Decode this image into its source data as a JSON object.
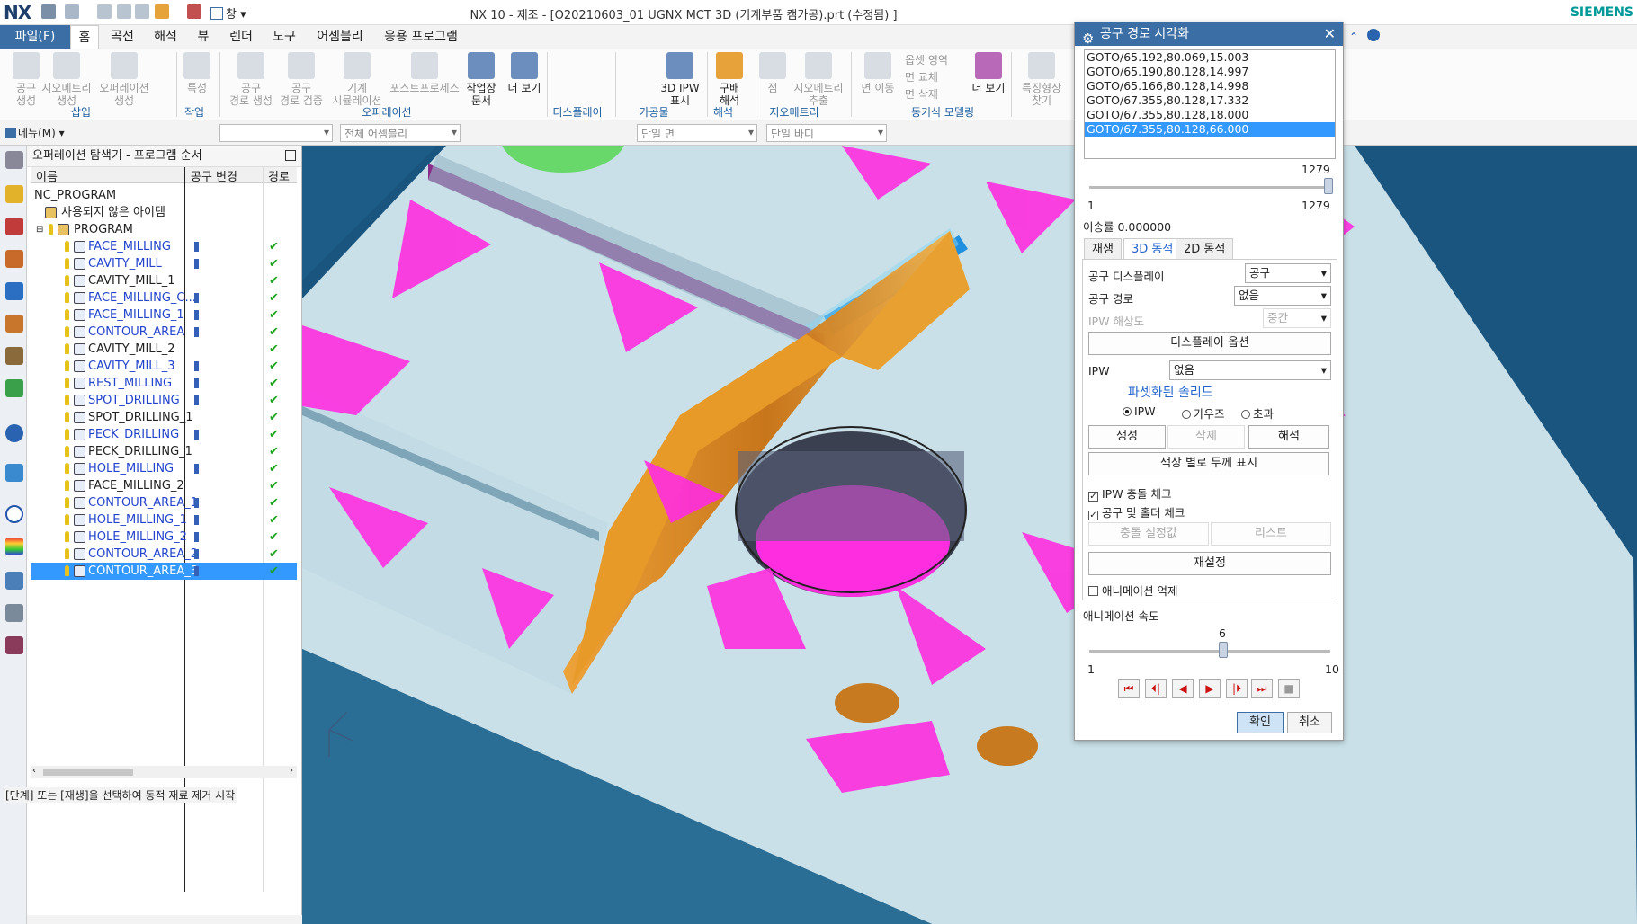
{
  "app": {
    "logo": "NX",
    "title": "NX 10 - 제조 - [O20210603_01 UGNX MCT 3D (기계부품 캠가공).prt (수정됨) ]",
    "brand": "SIEMENS",
    "window_menu": "창"
  },
  "tabs": [
    "파일(F)",
    "홈",
    "곡선",
    "해석",
    "뷰",
    "렌더",
    "도구",
    "어셈블리",
    "응용 프로그램"
  ],
  "ribbon": {
    "buttons": [
      {
        "label": "공구\n생성",
        "enabled": false
      },
      {
        "label": "지오메트리\n생성",
        "enabled": false
      },
      {
        "label": "오퍼레이션\n생성",
        "enabled": false
      },
      {
        "label": "특성",
        "enabled": false
      },
      {
        "label": "공구\n경로 생성",
        "enabled": false
      },
      {
        "label": "공구\n경로 검증",
        "enabled": false
      },
      {
        "label": "기계\n시뮬레이션",
        "enabled": false
      },
      {
        "label": "포스트프로세스",
        "enabled": false
      },
      {
        "label": "작업장\n문서",
        "enabled": true
      },
      {
        "label": "더 보기",
        "enabled": true
      },
      {
        "label": "3D IPW\n표시",
        "enabled": true
      },
      {
        "label": "구배\n해석",
        "enabled": true
      },
      {
        "label": "점",
        "enabled": false
      },
      {
        "label": "지오메트리\n추출",
        "enabled": false
      },
      {
        "label": "면 이동",
        "enabled": false
      },
      {
        "label": "옵셋 영역",
        "enabled": false
      },
      {
        "label": "면 교체",
        "enabled": false
      },
      {
        "label": "면 삭제",
        "enabled": false
      },
      {
        "label": "더 보기",
        "enabled": true
      },
      {
        "label": "특징형상\n찾기",
        "enabled": false
      }
    ],
    "groups": [
      "삽입",
      "작업",
      "오퍼레이션",
      "디스플레이",
      "가공물",
      "해석",
      "지오메트리",
      "동기식 모델링"
    ]
  },
  "toolbar2": {
    "menu_label": "메뉴(M)",
    "filter1": "",
    "filter2": "전체 어셈블리",
    "filter3": "단일 면",
    "filter4": "단일 바디"
  },
  "navigator": {
    "title": "오퍼레이션 탐색기 - 프로그램 순서",
    "columns": [
      "이름",
      "공구 변경",
      "경로"
    ],
    "root": "NC_PROGRAM",
    "unused": "사용되지 않은 아이템",
    "program": "PROGRAM",
    "operations": [
      {
        "name": "FACE_MILLING",
        "tool_change": true,
        "path_ok": true,
        "style": "blue"
      },
      {
        "name": "CAVITY_MILL",
        "tool_change": true,
        "path_ok": true,
        "style": "blue"
      },
      {
        "name": "CAVITY_MILL_1",
        "tool_change": false,
        "path_ok": true,
        "style": "dark"
      },
      {
        "name": "FACE_MILLING_C...",
        "tool_change": true,
        "path_ok": true,
        "style": "blue"
      },
      {
        "name": "FACE_MILLING_1",
        "tool_change": true,
        "path_ok": true,
        "style": "blue"
      },
      {
        "name": "CONTOUR_AREA",
        "tool_change": true,
        "path_ok": true,
        "style": "blue"
      },
      {
        "name": "CAVITY_MILL_2",
        "tool_change": false,
        "path_ok": true,
        "style": "dark"
      },
      {
        "name": "CAVITY_MILL_3",
        "tool_change": true,
        "path_ok": true,
        "style": "blue"
      },
      {
        "name": "REST_MILLING",
        "tool_change": true,
        "path_ok": true,
        "style": "blue"
      },
      {
        "name": "SPOT_DRILLING",
        "tool_change": true,
        "path_ok": true,
        "style": "blue"
      },
      {
        "name": "SPOT_DRILLING_1",
        "tool_change": false,
        "path_ok": true,
        "style": "dark"
      },
      {
        "name": "PECK_DRILLING",
        "tool_change": true,
        "path_ok": true,
        "style": "blue"
      },
      {
        "name": "PECK_DRILLING_1",
        "tool_change": false,
        "path_ok": true,
        "style": "dark"
      },
      {
        "name": "HOLE_MILLING",
        "tool_change": true,
        "path_ok": true,
        "style": "blue"
      },
      {
        "name": "FACE_MILLING_2",
        "tool_change": false,
        "path_ok": true,
        "style": "dark"
      },
      {
        "name": "CONTOUR_AREA_1",
        "tool_change": true,
        "path_ok": true,
        "style": "blue"
      },
      {
        "name": "HOLE_MILLING_1",
        "tool_change": true,
        "path_ok": true,
        "style": "blue"
      },
      {
        "name": "HOLE_MILLING_2",
        "tool_change": true,
        "path_ok": true,
        "style": "blue"
      },
      {
        "name": "CONTOUR_AREA_2",
        "tool_change": true,
        "path_ok": true,
        "style": "blue"
      },
      {
        "name": "CONTOUR_AREA_3",
        "tool_change": true,
        "path_ok": true,
        "style": "blue",
        "selected": true
      }
    ]
  },
  "status_text": "[단계] 또는 [재생]을 선택하여 동적 재료 제거 시작",
  "dialog": {
    "title": "공구 경로 시각화",
    "goto_list": [
      "GOTO/65.192,80.069,15.003",
      "GOTO/65.190,80.128,14.997",
      "GOTO/65.166,80.128,14.998",
      "GOTO/67.355,80.128,17.332",
      "GOTO/67.355,80.128,18.000",
      "GOTO/67.355,80.128,66.000"
    ],
    "selected_index": 5,
    "slider": {
      "value": "1279",
      "min": "1",
      "max": "1279",
      "fraction": 1.0
    },
    "feed_label": "이송률 0.000000",
    "tabs": [
      "재생",
      "3D 동적",
      "2D 동적"
    ],
    "active_tab": 1,
    "tool_display_label": "공구 디스플레이",
    "tool_display_value": "공구",
    "tool_path_label": "공구 경로",
    "tool_path_value": "없음",
    "ipw_res_label": "IPW 해상도",
    "ipw_res_value": "중간",
    "display_options": "디스플레이 옵션",
    "ipw_label": "IPW",
    "ipw_value": "없음",
    "faceted_title": "파셋화된 솔리드",
    "radio": [
      "IPW",
      "가우즈",
      "초과"
    ],
    "radio_selected": 0,
    "btn_create": "생성",
    "btn_delete": "삭제",
    "btn_analyze": "해석",
    "btn_color_thickness": "색상 별로 두께 표시",
    "chk_ipw_collision": "IPW 충돌 체크",
    "chk_tool_holder": "공구 및 홀더 체크",
    "btn_collision_settings": "충돌 설정값",
    "btn_list": "리스트",
    "btn_reset": "재설정",
    "chk_suppress_anim": "애니메이션 억제",
    "anim_speed_label": "애니메이션 속도",
    "speed": {
      "value": "6",
      "min": "1",
      "max": "10",
      "fraction": 0.5556
    },
    "ok": "확인",
    "cancel": "취소"
  },
  "colors": {
    "accent": "#3a6ea5",
    "selection": "#3399ff",
    "magenta": "#ff2de0",
    "stock": "#c8dfe8",
    "orange": "#e08a1a",
    "check": "#1aa31a"
  }
}
